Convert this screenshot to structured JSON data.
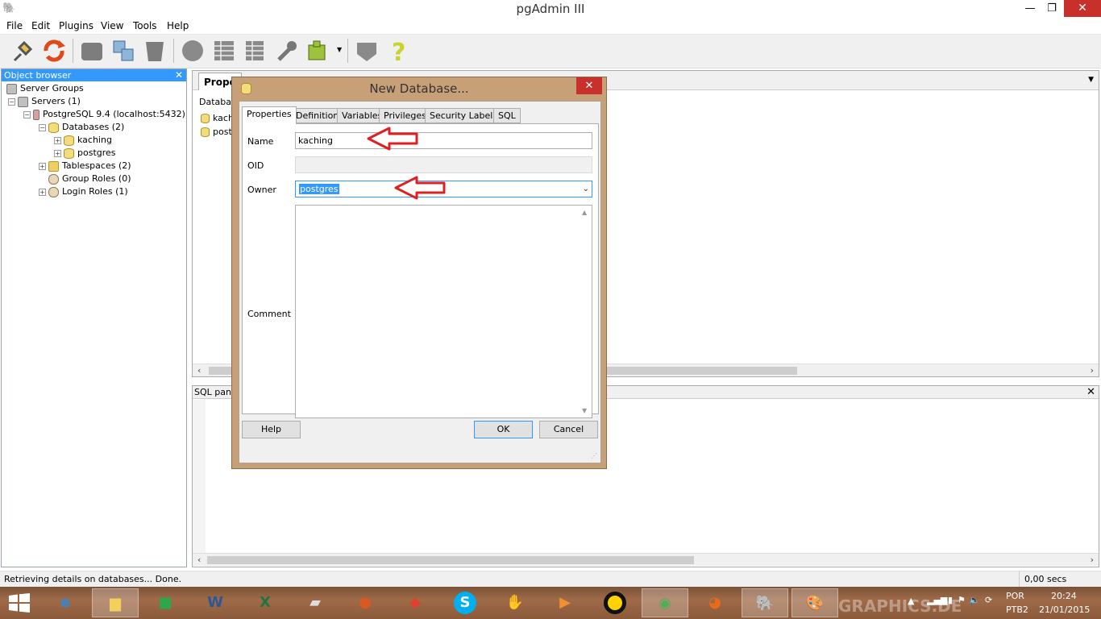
{
  "window": {
    "title": "pgAdmin III"
  },
  "menu": [
    "File",
    "Edit",
    "Plugins",
    "View",
    "Tools",
    "Help"
  ],
  "object_browser": {
    "title": "Object browser",
    "tree": [
      {
        "label": "Server Groups",
        "icon": "server-groups-icon"
      },
      {
        "label": "Servers (1)",
        "icon": "servers-icon"
      },
      {
        "label": "PostgreSQL 9.4 (localhost:5432)",
        "icon": "server-icon"
      },
      {
        "label": "Databases (2)",
        "icon": "databases-icon"
      },
      {
        "label": "kaching",
        "icon": "database-icon"
      },
      {
        "label": "postgres",
        "icon": "database-icon"
      },
      {
        "label": "Tablespaces (2)",
        "icon": "tablespaces-icon"
      },
      {
        "label": "Group Roles (0)",
        "icon": "group-roles-icon"
      },
      {
        "label": "Login Roles (1)",
        "icon": "login-roles-icon"
      }
    ]
  },
  "properties_pane": {
    "tab": "Prope",
    "list_header": "Databas",
    "rows": [
      "kachi",
      "postg"
    ]
  },
  "sql_pane": {
    "title": "SQL pane"
  },
  "status": {
    "left": "Retrieving details on databases... Done.",
    "right": "0,00 secs"
  },
  "dialog": {
    "title": "New Database...",
    "tabs": [
      "Properties",
      "Definition",
      "Variables",
      "Privileges",
      "Security Labels",
      "SQL"
    ],
    "active_tab": "Properties",
    "fields": {
      "name_label": "Name",
      "name_value": "kaching",
      "oid_label": "OID",
      "oid_value": "",
      "owner_label": "Owner",
      "owner_value": "postgres",
      "comment_label": "Comment"
    },
    "buttons": {
      "help": "Help",
      "ok": "OK",
      "cancel": "Cancel"
    }
  },
  "tray": {
    "lang1": "POR",
    "lang2": "PTB2",
    "time": "20:24",
    "date": "21/01/2015",
    "watermark": "GRAPHICS.DE"
  },
  "colors": {
    "accent": "#3399ff",
    "close": "#c7302b",
    "arrow": "#e02020"
  }
}
